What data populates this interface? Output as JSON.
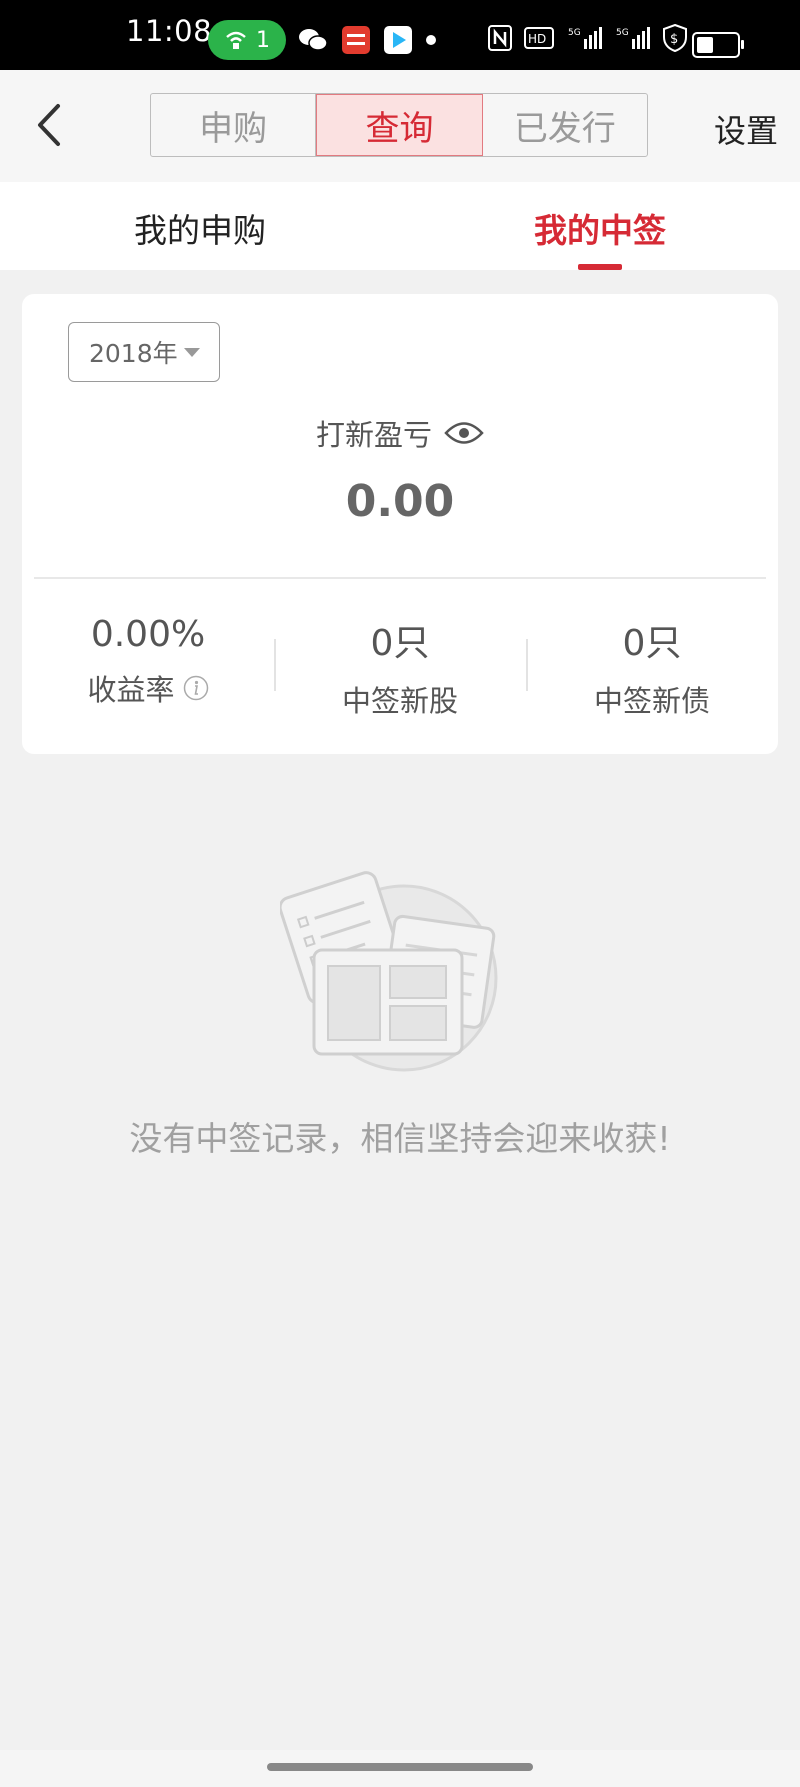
{
  "status": {
    "time": "11:08",
    "hotspot_count": "1",
    "network": "5G",
    "hd": "HD2",
    "icons": [
      "wifi-hotspot-icon",
      "wechat-icon",
      "pingan-app-icon",
      "video-app-icon",
      "nfc-icon",
      "signal-icon",
      "shield-icon",
      "battery-icon"
    ]
  },
  "nav": {
    "segments": [
      "申购",
      "查询",
      "已发行"
    ],
    "active_segment": "查询",
    "settings_label": "设置"
  },
  "tabs": {
    "items": [
      "我的申购",
      "我的中签"
    ],
    "active": "我的中签"
  },
  "card": {
    "year": "2018年",
    "pl_label": "打新盈亏",
    "pl_value": "0.00",
    "stats": [
      {
        "value": "0.00%",
        "label": "收益率"
      },
      {
        "value": "0只",
        "label": "中签新股"
      },
      {
        "value": "0只",
        "label": "中签新债"
      }
    ]
  },
  "empty": {
    "message": "没有中签记录，相信坚持会迎来收获!"
  },
  "colors": {
    "accent": "#d62a35",
    "background": "#f1f1f1"
  }
}
